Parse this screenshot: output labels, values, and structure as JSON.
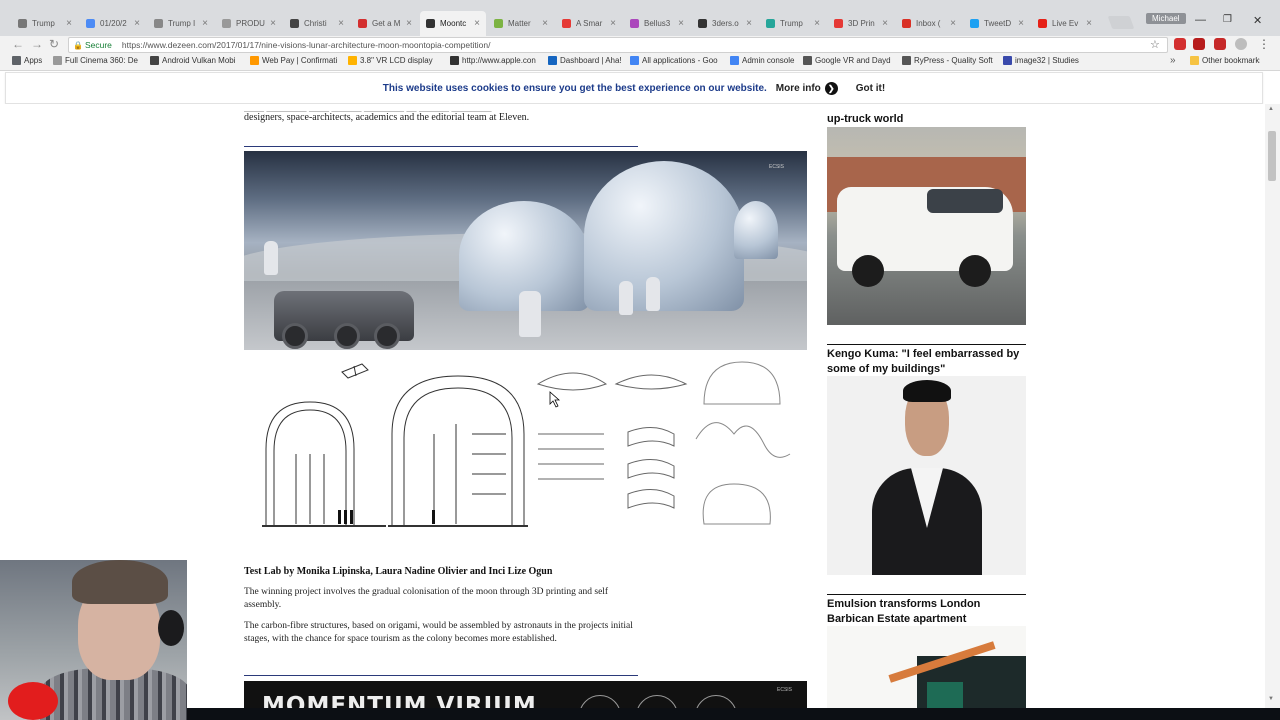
{
  "browser": {
    "tabs": [
      {
        "title": "Trump",
        "color": "#777"
      },
      {
        "title": "01/20/2",
        "color": "#4c8bf5"
      },
      {
        "title": "Trump I",
        "color": "#888"
      },
      {
        "title": "PRODU",
        "color": "#999"
      },
      {
        "title": "Christi",
        "color": "#444"
      },
      {
        "title": "Get a M",
        "color": "#d32f2f"
      },
      {
        "title": "Moontc",
        "color": "#333"
      },
      {
        "title": "Matter",
        "color": "#7cb342"
      },
      {
        "title": "A Smar",
        "color": "#e53935"
      },
      {
        "title": "Bellus3",
        "color": "#ab47bc"
      },
      {
        "title": "3ders.o",
        "color": "#333"
      },
      {
        "title": "Trump",
        "color": "#26a69a"
      },
      {
        "title": "3D Prin",
        "color": "#e53935"
      },
      {
        "title": "Inbox (",
        "color": "#d93025"
      },
      {
        "title": "TweetD",
        "color": "#1da1f2"
      },
      {
        "title": "Live Ev",
        "color": "#e62117"
      }
    ],
    "active_tab_index": 6,
    "profile_name": "Michael",
    "address": {
      "secure_label": "Secure",
      "url": "https://www.dezeen.com/2017/01/17/nine-visions-lunar-architecture-moon-moontopia-competition/"
    },
    "bookmarks": [
      {
        "label": "Apps",
        "color": "#5f6368"
      },
      {
        "label": "Full Cinema 360: De",
        "color": "#999"
      },
      {
        "label": "Android Vulkan Mobi",
        "color": "#444"
      },
      {
        "label": "Web Pay | Confirmati",
        "color": "#ff9800"
      },
      {
        "label": "3.8\" VR LCD display",
        "color": "#ffb300"
      },
      {
        "label": "http://www.apple.con",
        "color": "#333"
      },
      {
        "label": "Dashboard | Aha!",
        "color": "#1565c0"
      },
      {
        "label": "All applications - Goo",
        "color": "#4285f4"
      },
      {
        "label": "Admin console",
        "color": "#4285f4"
      },
      {
        "label": "Google VR and Dayd",
        "color": "#555"
      },
      {
        "label": "RyPress - Quality Soft",
        "color": "#555"
      },
      {
        "label": "image32 | Studies",
        "color": "#3949ab"
      },
      {
        "label": "Other bookmarks",
        "color": "#f6c343"
      }
    ]
  },
  "cookie_bar": {
    "message": "This website uses cookies to ensure you get the best experience on our website.",
    "more_info": "More info",
    "got_it": "Got it!"
  },
  "article": {
    "intro_fragment": "designers, space-architects, academics and the editorial team at Eleven.",
    "image_watermark": "ECSIS",
    "caption": "Test Lab by Monika Lipinska, Laura Nadine Olivier and Inci Lize Ogun",
    "paragraph_1": "The winning project involves the gradual colonisation of the moon through 3D printing and self assembly.",
    "paragraph_2": "The carbon-fibre structures, based on origami, would be assembled by astronauts in the projects initial stages, with the chance for space tourism as the colony becomes more established.",
    "next_image_title": "MOMENTUM VIRIUM",
    "next_image_watermark": "ECSIS"
  },
  "sidebar": {
    "story_1_title": "up-truck world",
    "story_2_title": "Kengo Kuma: \"I feel embarrassed by some of my buildings\"",
    "story_3_title": "Emulsion transforms London Barbican Estate apartment"
  }
}
